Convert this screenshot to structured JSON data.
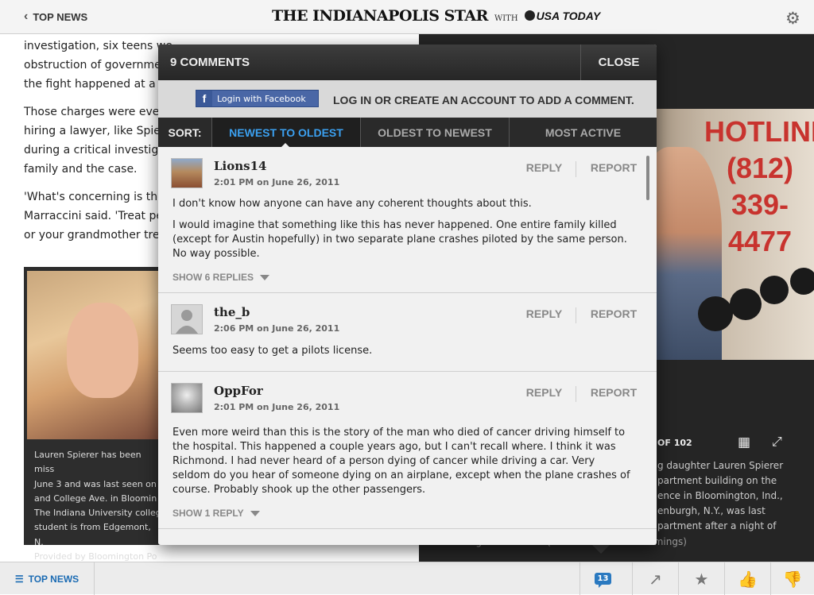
{
  "topbar": {
    "back_label": "TOP NEWS",
    "masthead": "THE INDIANAPOLIS STAR",
    "with": "WITH",
    "partner": "USA TODAY"
  },
  "article": {
    "paragraphs": [
      "investigation, six teens we",
      "obstruction of governmen",
      "the fight happened at a p",
      "Those charges were event",
      "hiring a lawyer, like Spiere",
      "during a critical investigati",
      "family and the case.",
      "'What's concerning is their",
      "Marraccini said. 'Treat peo",
      "or your grandmother treat"
    ],
    "photo_caption": [
      "Lauren Spierer has been miss",
      "June 3 and was last seen on",
      "and College Ave. in Bloomin",
      "The Indiana University colleg",
      "student is from Edgemont, N.",
      "Provided by Bloomington Po"
    ]
  },
  "gallery": {
    "hotline": [
      "HOTLINE",
      "(812)",
      "339-4477"
    ],
    "count": "OF 102",
    "caption": [
      "g daughter Lauren Spierer",
      "partment building on the",
      "ence in Bloomington, Ind.,",
      "enburgh, N.Y., was last",
      "partment after a night of"
    ],
    "caption_tail": "drinking with friends. (AP Photo/Darron Cummings)"
  },
  "modal": {
    "title": "9 COMMENTS",
    "close": "CLOSE",
    "facebook_label": "Login with Facebook",
    "login_prompt": "LOG IN OR CREATE AN ACCOUNT TO ADD A COMMENT.",
    "sort_label": "SORT:",
    "sort_tabs": [
      "NEWEST TO OLDEST",
      "OLDEST TO NEWEST",
      "MOST ACTIVE"
    ],
    "reply_label": "REPLY",
    "report_label": "REPORT",
    "comments": [
      {
        "user": "Lions14",
        "time": "2:01 PM on June 26, 2011",
        "text": [
          "I don't know how anyone can have any coherent thoughts about this.",
          "I would imagine that something like this has never happened. One entire family killed (except for Austin hopefully) in two separate plane crashes piloted by the same person. No way possible."
        ],
        "replies": "SHOW 6 REPLIES"
      },
      {
        "user": "the_b",
        "time": "2:06 PM on June 26, 2011",
        "text": [
          "Seems too easy to get a pilots license."
        ],
        "replies": ""
      },
      {
        "user": "OppFor",
        "time": "2:01 PM on June 26, 2011",
        "text": [
          "Even more weird than this is the story of the man who died of cancer driving himself to the hospital. This happened a couple years ago, but I can't recall where. I think it was Richmond. I had never heard of a person dying of cancer while driving a car. Very seldom do you hear of someone dying on an airplane, except when the plane crashes of course. Probably shook up the other passengers."
        ],
        "replies": "SHOW 1 REPLY"
      }
    ]
  },
  "bottombar": {
    "top_news": "TOP NEWS",
    "comment_count": "13"
  }
}
